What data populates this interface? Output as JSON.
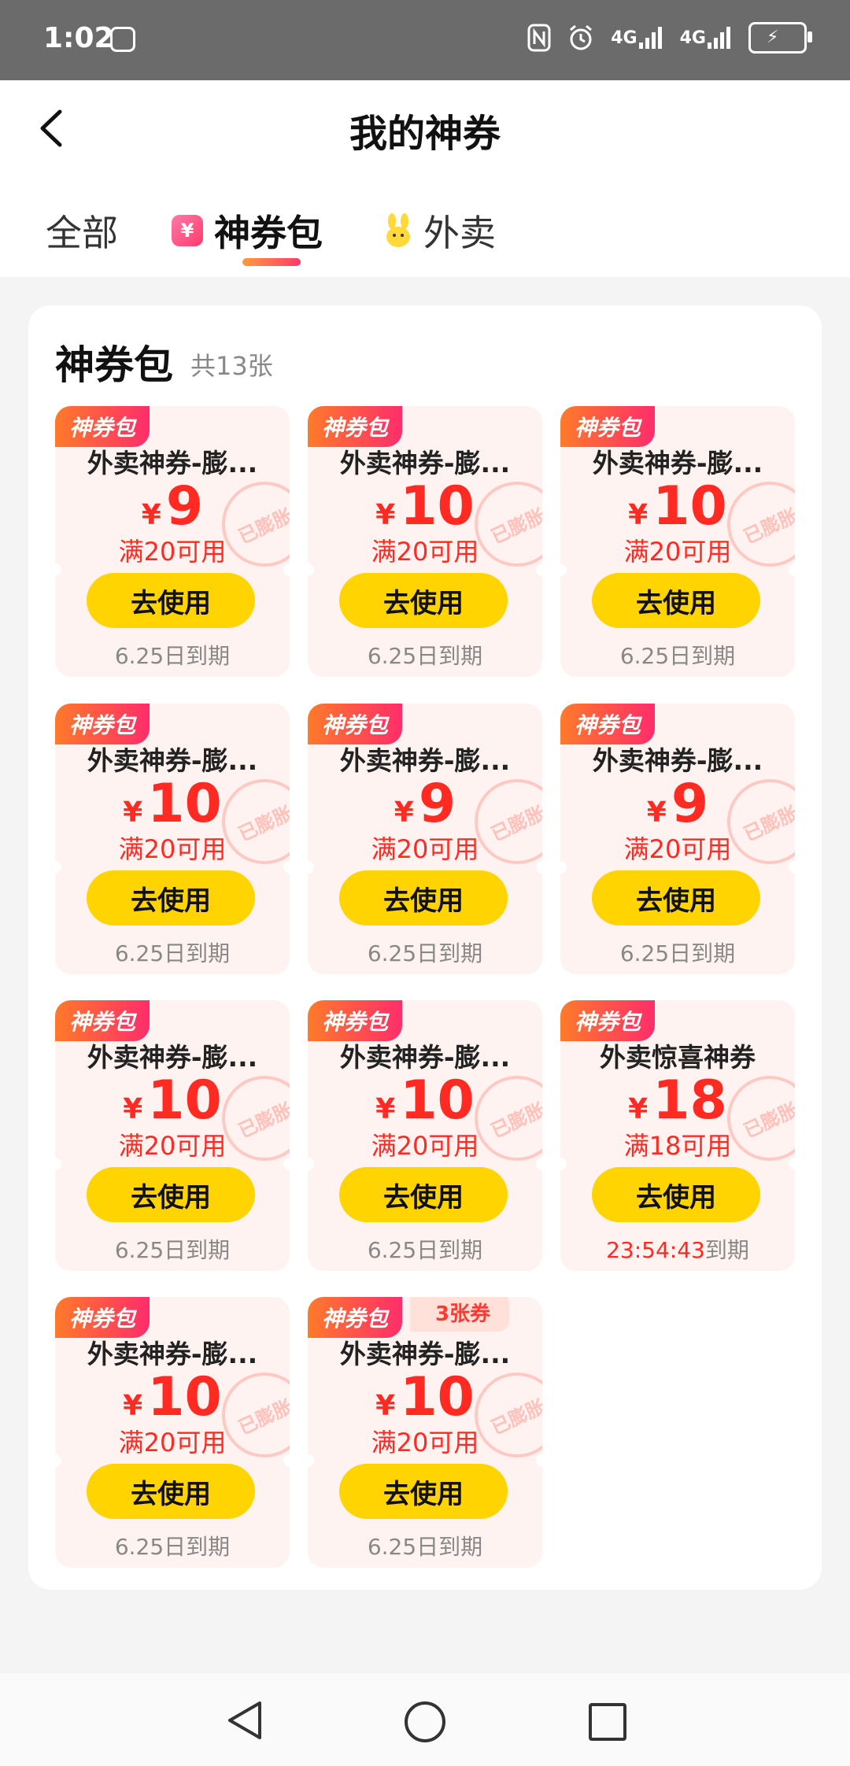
{
  "status_bar": {
    "time": "1:02",
    "net1": "4G",
    "net2": "4G"
  },
  "header": {
    "title": "我的神券"
  },
  "tabs": [
    {
      "label": "全部",
      "active": false
    },
    {
      "label": "神券包",
      "active": true,
      "icon": "coupon-bag-icon",
      "icon_text": "¥"
    },
    {
      "label": "外卖",
      "active": false,
      "icon": "rabbit-icon"
    }
  ],
  "panel": {
    "title": "神券包",
    "count_text": "共13张"
  },
  "coupons": [
    {
      "badge": "神券包",
      "name": "外卖神券-膨...",
      "currency": "¥",
      "amount": "9",
      "condition": "满20可用",
      "stamp": "已膨胀",
      "button": "去使用",
      "expire": "6.25日到期"
    },
    {
      "badge": "神券包",
      "name": "外卖神券-膨...",
      "currency": "¥",
      "amount": "10",
      "condition": "满20可用",
      "stamp": "已膨胀",
      "button": "去使用",
      "expire": "6.25日到期"
    },
    {
      "badge": "神券包",
      "name": "外卖神券-膨...",
      "currency": "¥",
      "amount": "10",
      "condition": "满20可用",
      "stamp": "已膨胀",
      "button": "去使用",
      "expire": "6.25日到期"
    },
    {
      "badge": "神券包",
      "name": "外卖神券-膨...",
      "currency": "¥",
      "amount": "10",
      "condition": "满20可用",
      "stamp": "已膨胀",
      "button": "去使用",
      "expire": "6.25日到期"
    },
    {
      "badge": "神券包",
      "name": "外卖神券-膨...",
      "currency": "¥",
      "amount": "9",
      "condition": "满20可用",
      "stamp": "已膨胀",
      "button": "去使用",
      "expire": "6.25日到期"
    },
    {
      "badge": "神券包",
      "name": "外卖神券-膨...",
      "currency": "¥",
      "amount": "9",
      "condition": "满20可用",
      "stamp": "已膨胀",
      "button": "去使用",
      "expire": "6.25日到期"
    },
    {
      "badge": "神券包",
      "name": "外卖神券-膨...",
      "currency": "¥",
      "amount": "10",
      "condition": "满20可用",
      "stamp": "已膨胀",
      "button": "去使用",
      "expire": "6.25日到期"
    },
    {
      "badge": "神券包",
      "name": "外卖神券-膨...",
      "currency": "¥",
      "amount": "10",
      "condition": "满20可用",
      "stamp": "已膨胀",
      "button": "去使用",
      "expire": "6.25日到期"
    },
    {
      "badge": "神券包",
      "name": "外卖惊喜神券",
      "currency": "¥",
      "amount": "18",
      "condition": "满18可用",
      "stamp": "已膨胀",
      "button": "去使用",
      "expire_countdown": "23:54:43",
      "expire_suffix": "到期"
    },
    {
      "badge": "神券包",
      "name": "外卖神券-膨...",
      "currency": "¥",
      "amount": "10",
      "condition": "满20可用",
      "stamp": "已膨胀",
      "button": "去使用",
      "expire": "6.25日到期"
    },
    {
      "badge": "神券包",
      "extra_badge": "3张券",
      "name": "外卖神券-膨...",
      "currency": "¥",
      "amount": "10",
      "condition": "满20可用",
      "stamp": "已膨胀",
      "button": "去使用",
      "expire": "6.25日到期"
    }
  ],
  "colors": {
    "accent_red": "#ff2a22",
    "button_yellow": "#ffd400",
    "badge_gradient_start": "#ff7a2a",
    "badge_gradient_end": "#ff2d6a"
  }
}
